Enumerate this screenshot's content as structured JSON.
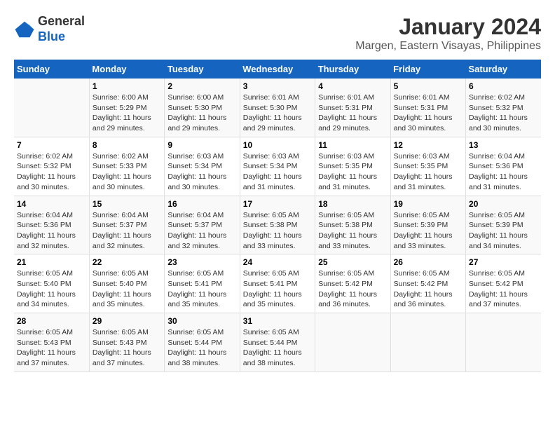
{
  "logo": {
    "line1": "General",
    "line2": "Blue"
  },
  "title": "January 2024",
  "subtitle": "Margen, Eastern Visayas, Philippines",
  "days_of_week": [
    "Sunday",
    "Monday",
    "Tuesday",
    "Wednesday",
    "Thursday",
    "Friday",
    "Saturday"
  ],
  "weeks": [
    [
      {
        "day": "",
        "sunrise": "",
        "sunset": "",
        "daylight": ""
      },
      {
        "day": "1",
        "sunrise": "Sunrise: 6:00 AM",
        "sunset": "Sunset: 5:29 PM",
        "daylight": "Daylight: 11 hours and 29 minutes."
      },
      {
        "day": "2",
        "sunrise": "Sunrise: 6:00 AM",
        "sunset": "Sunset: 5:30 PM",
        "daylight": "Daylight: 11 hours and 29 minutes."
      },
      {
        "day": "3",
        "sunrise": "Sunrise: 6:01 AM",
        "sunset": "Sunset: 5:30 PM",
        "daylight": "Daylight: 11 hours and 29 minutes."
      },
      {
        "day": "4",
        "sunrise": "Sunrise: 6:01 AM",
        "sunset": "Sunset: 5:31 PM",
        "daylight": "Daylight: 11 hours and 29 minutes."
      },
      {
        "day": "5",
        "sunrise": "Sunrise: 6:01 AM",
        "sunset": "Sunset: 5:31 PM",
        "daylight": "Daylight: 11 hours and 30 minutes."
      },
      {
        "day": "6",
        "sunrise": "Sunrise: 6:02 AM",
        "sunset": "Sunset: 5:32 PM",
        "daylight": "Daylight: 11 hours and 30 minutes."
      }
    ],
    [
      {
        "day": "7",
        "sunrise": "Sunrise: 6:02 AM",
        "sunset": "Sunset: 5:32 PM",
        "daylight": "Daylight: 11 hours and 30 minutes."
      },
      {
        "day": "8",
        "sunrise": "Sunrise: 6:02 AM",
        "sunset": "Sunset: 5:33 PM",
        "daylight": "Daylight: 11 hours and 30 minutes."
      },
      {
        "day": "9",
        "sunrise": "Sunrise: 6:03 AM",
        "sunset": "Sunset: 5:34 PM",
        "daylight": "Daylight: 11 hours and 30 minutes."
      },
      {
        "day": "10",
        "sunrise": "Sunrise: 6:03 AM",
        "sunset": "Sunset: 5:34 PM",
        "daylight": "Daylight: 11 hours and 31 minutes."
      },
      {
        "day": "11",
        "sunrise": "Sunrise: 6:03 AM",
        "sunset": "Sunset: 5:35 PM",
        "daylight": "Daylight: 11 hours and 31 minutes."
      },
      {
        "day": "12",
        "sunrise": "Sunrise: 6:03 AM",
        "sunset": "Sunset: 5:35 PM",
        "daylight": "Daylight: 11 hours and 31 minutes."
      },
      {
        "day": "13",
        "sunrise": "Sunrise: 6:04 AM",
        "sunset": "Sunset: 5:36 PM",
        "daylight": "Daylight: 11 hours and 31 minutes."
      }
    ],
    [
      {
        "day": "14",
        "sunrise": "Sunrise: 6:04 AM",
        "sunset": "Sunset: 5:36 PM",
        "daylight": "Daylight: 11 hours and 32 minutes."
      },
      {
        "day": "15",
        "sunrise": "Sunrise: 6:04 AM",
        "sunset": "Sunset: 5:37 PM",
        "daylight": "Daylight: 11 hours and 32 minutes."
      },
      {
        "day": "16",
        "sunrise": "Sunrise: 6:04 AM",
        "sunset": "Sunset: 5:37 PM",
        "daylight": "Daylight: 11 hours and 32 minutes."
      },
      {
        "day": "17",
        "sunrise": "Sunrise: 6:05 AM",
        "sunset": "Sunset: 5:38 PM",
        "daylight": "Daylight: 11 hours and 33 minutes."
      },
      {
        "day": "18",
        "sunrise": "Sunrise: 6:05 AM",
        "sunset": "Sunset: 5:38 PM",
        "daylight": "Daylight: 11 hours and 33 minutes."
      },
      {
        "day": "19",
        "sunrise": "Sunrise: 6:05 AM",
        "sunset": "Sunset: 5:39 PM",
        "daylight": "Daylight: 11 hours and 33 minutes."
      },
      {
        "day": "20",
        "sunrise": "Sunrise: 6:05 AM",
        "sunset": "Sunset: 5:39 PM",
        "daylight": "Daylight: 11 hours and 34 minutes."
      }
    ],
    [
      {
        "day": "21",
        "sunrise": "Sunrise: 6:05 AM",
        "sunset": "Sunset: 5:40 PM",
        "daylight": "Daylight: 11 hours and 34 minutes."
      },
      {
        "day": "22",
        "sunrise": "Sunrise: 6:05 AM",
        "sunset": "Sunset: 5:40 PM",
        "daylight": "Daylight: 11 hours and 35 minutes."
      },
      {
        "day": "23",
        "sunrise": "Sunrise: 6:05 AM",
        "sunset": "Sunset: 5:41 PM",
        "daylight": "Daylight: 11 hours and 35 minutes."
      },
      {
        "day": "24",
        "sunrise": "Sunrise: 6:05 AM",
        "sunset": "Sunset: 5:41 PM",
        "daylight": "Daylight: 11 hours and 35 minutes."
      },
      {
        "day": "25",
        "sunrise": "Sunrise: 6:05 AM",
        "sunset": "Sunset: 5:42 PM",
        "daylight": "Daylight: 11 hours and 36 minutes."
      },
      {
        "day": "26",
        "sunrise": "Sunrise: 6:05 AM",
        "sunset": "Sunset: 5:42 PM",
        "daylight": "Daylight: 11 hours and 36 minutes."
      },
      {
        "day": "27",
        "sunrise": "Sunrise: 6:05 AM",
        "sunset": "Sunset: 5:42 PM",
        "daylight": "Daylight: 11 hours and 37 minutes."
      }
    ],
    [
      {
        "day": "28",
        "sunrise": "Sunrise: 6:05 AM",
        "sunset": "Sunset: 5:43 PM",
        "daylight": "Daylight: 11 hours and 37 minutes."
      },
      {
        "day": "29",
        "sunrise": "Sunrise: 6:05 AM",
        "sunset": "Sunset: 5:43 PM",
        "daylight": "Daylight: 11 hours and 37 minutes."
      },
      {
        "day": "30",
        "sunrise": "Sunrise: 6:05 AM",
        "sunset": "Sunset: 5:44 PM",
        "daylight": "Daylight: 11 hours and 38 minutes."
      },
      {
        "day": "31",
        "sunrise": "Sunrise: 6:05 AM",
        "sunset": "Sunset: 5:44 PM",
        "daylight": "Daylight: 11 hours and 38 minutes."
      },
      {
        "day": "",
        "sunrise": "",
        "sunset": "",
        "daylight": ""
      },
      {
        "day": "",
        "sunrise": "",
        "sunset": "",
        "daylight": ""
      },
      {
        "day": "",
        "sunrise": "",
        "sunset": "",
        "daylight": ""
      }
    ]
  ]
}
